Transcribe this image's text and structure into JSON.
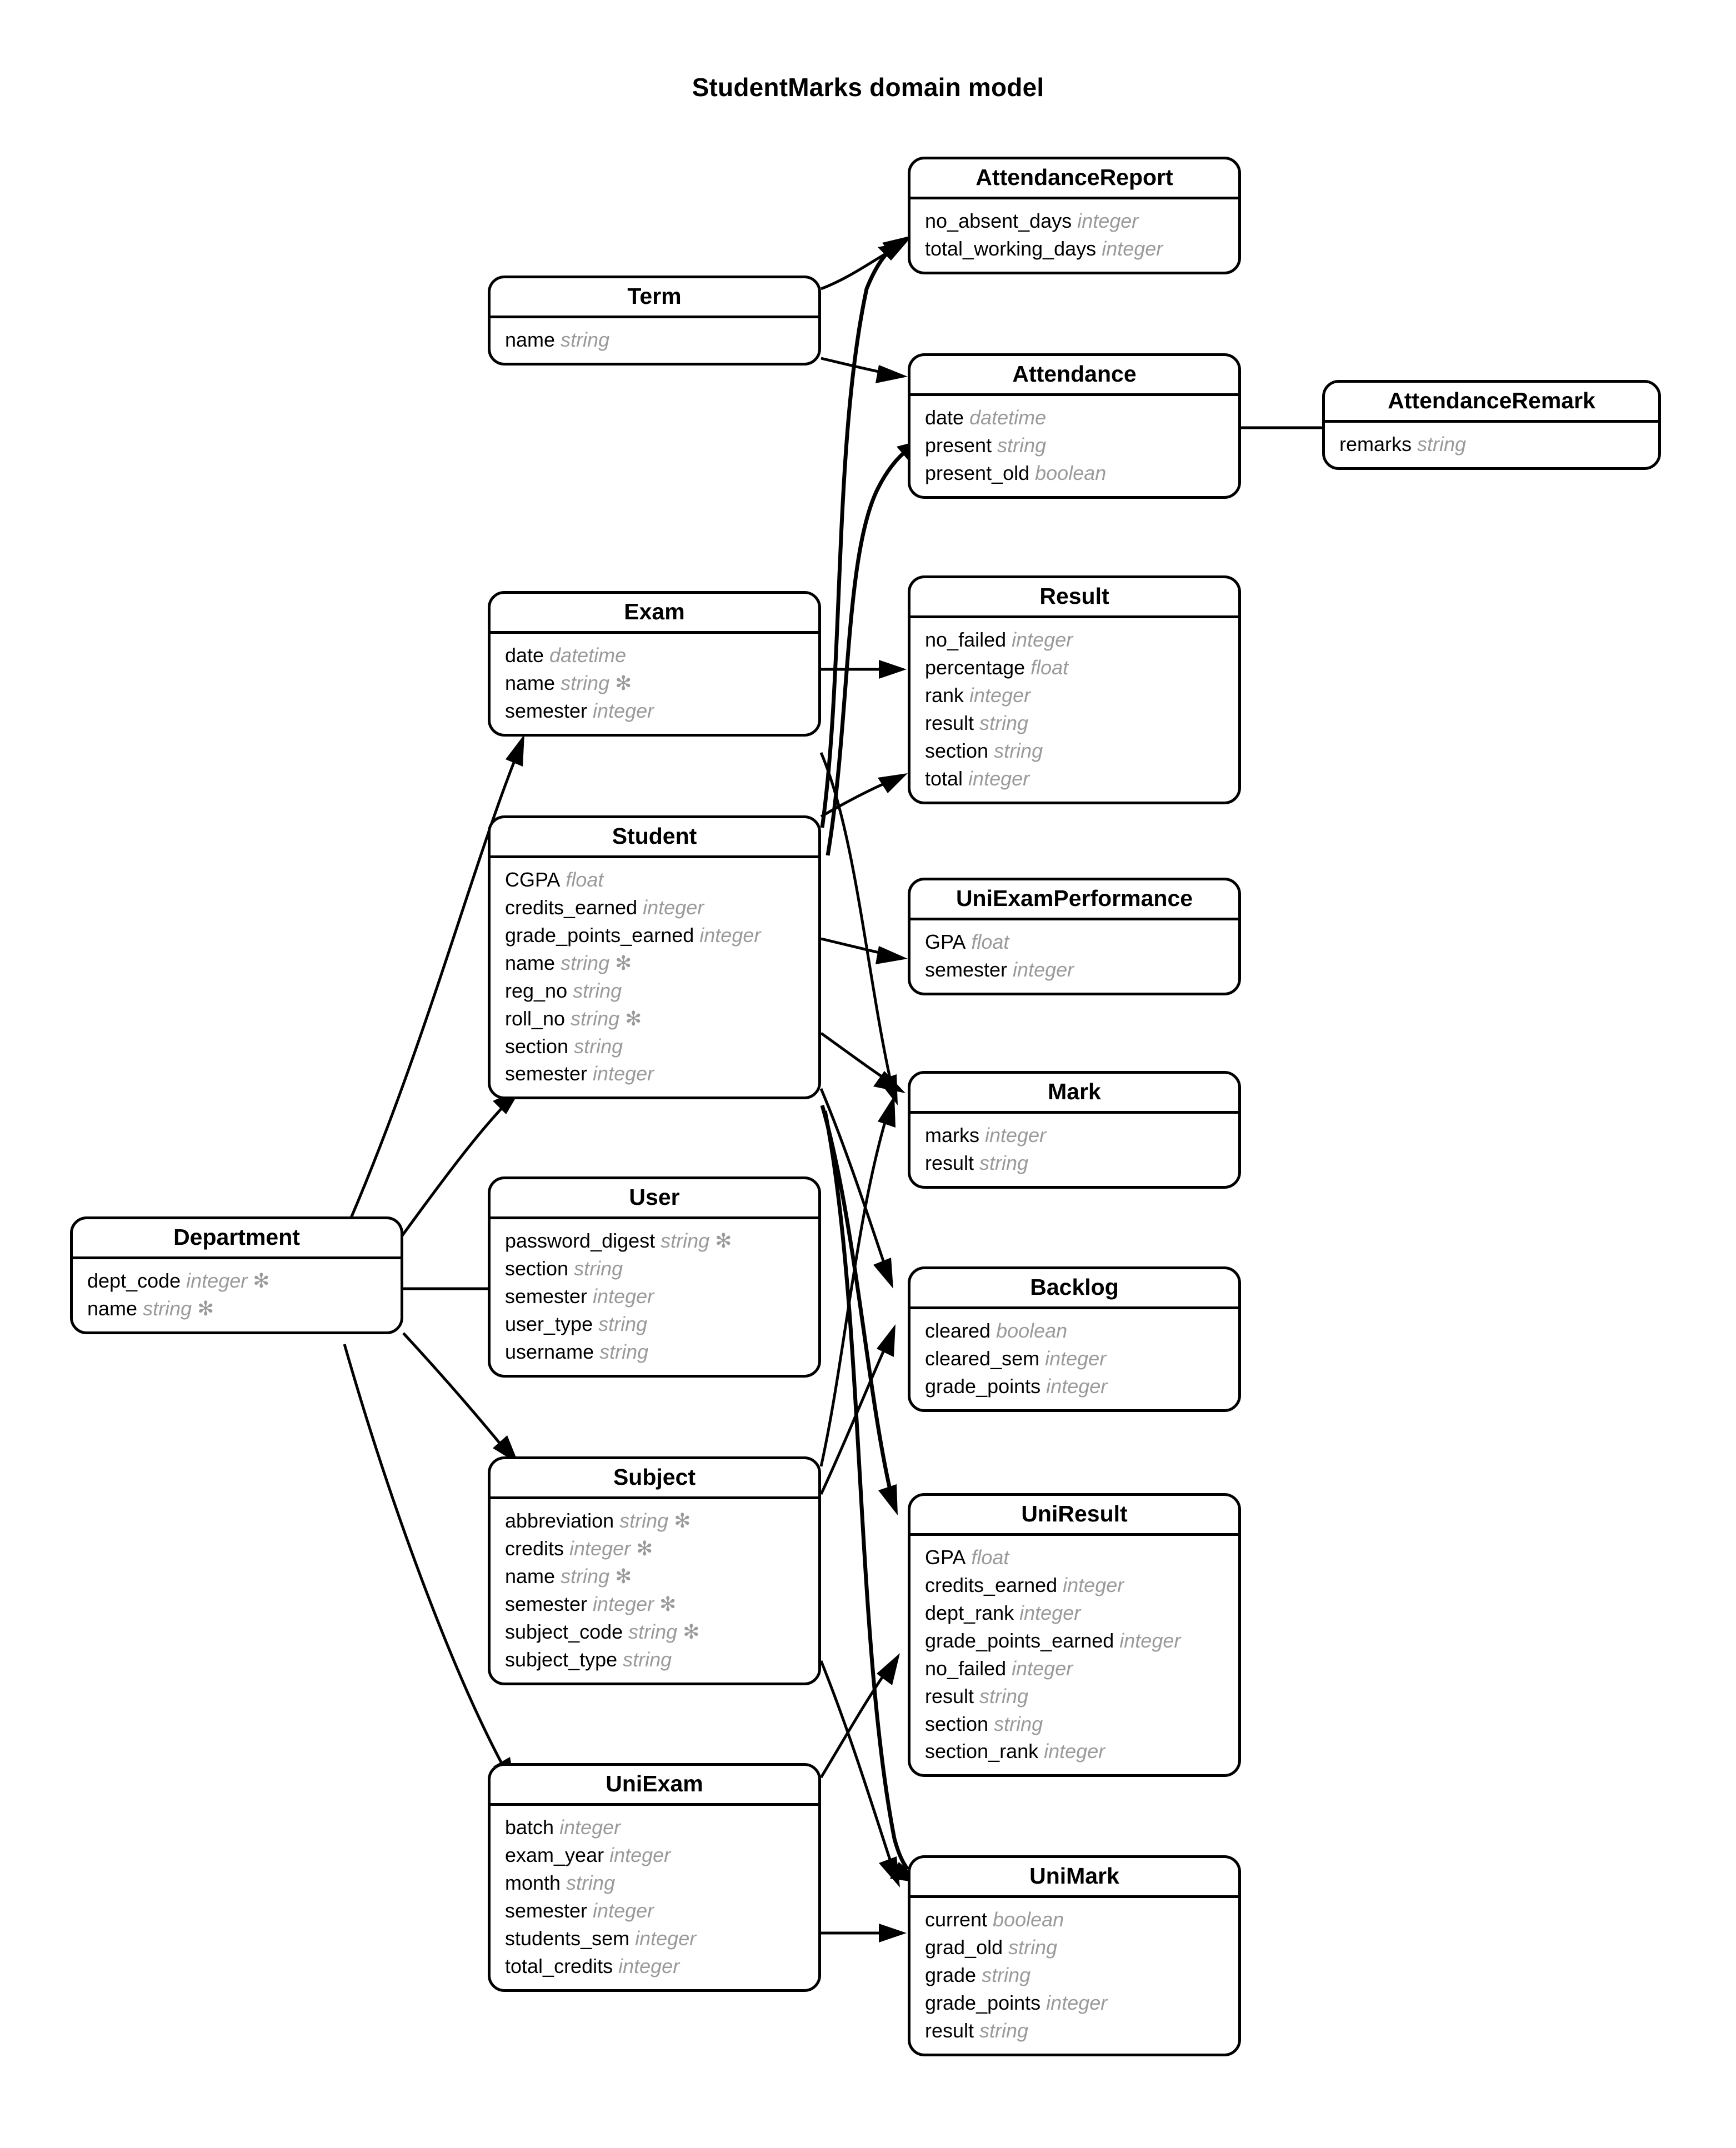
{
  "title": "StudentMarks domain model",
  "entities": [
    {
      "id": "attendance_report",
      "name": "AttendanceReport",
      "attributes": [
        {
          "name": "no_absent_days",
          "type": "integer",
          "required": false
        },
        {
          "name": "total_working_days",
          "type": "integer",
          "required": false
        }
      ]
    },
    {
      "id": "term",
      "name": "Term",
      "attributes": [
        {
          "name": "name",
          "type": "string",
          "required": false
        }
      ]
    },
    {
      "id": "attendance",
      "name": "Attendance",
      "attributes": [
        {
          "name": "date",
          "type": "datetime",
          "required": false
        },
        {
          "name": "present",
          "type": "string",
          "required": false
        },
        {
          "name": "present_old",
          "type": "boolean",
          "required": false
        }
      ]
    },
    {
      "id": "attendance_remark",
      "name": "AttendanceRemark",
      "attributes": [
        {
          "name": "remarks",
          "type": "string",
          "required": false
        }
      ]
    },
    {
      "id": "exam",
      "name": "Exam",
      "attributes": [
        {
          "name": "date",
          "type": "datetime",
          "required": false
        },
        {
          "name": "name",
          "type": "string",
          "required": true
        },
        {
          "name": "semester",
          "type": "integer",
          "required": false
        }
      ]
    },
    {
      "id": "result",
      "name": "Result",
      "attributes": [
        {
          "name": "no_failed",
          "type": "integer",
          "required": false
        },
        {
          "name": "percentage",
          "type": "float",
          "required": false
        },
        {
          "name": "rank",
          "type": "integer",
          "required": false
        },
        {
          "name": "result",
          "type": "string",
          "required": false
        },
        {
          "name": "section",
          "type": "string",
          "required": false
        },
        {
          "name": "total",
          "type": "integer",
          "required": false
        }
      ]
    },
    {
      "id": "student",
      "name": "Student",
      "attributes": [
        {
          "name": "CGPA",
          "type": "float",
          "required": false
        },
        {
          "name": "credits_earned",
          "type": "integer",
          "required": false
        },
        {
          "name": "grade_points_earned",
          "type": "integer",
          "required": false
        },
        {
          "name": "name",
          "type": "string",
          "required": true
        },
        {
          "name": "reg_no",
          "type": "string",
          "required": false
        },
        {
          "name": "roll_no",
          "type": "string",
          "required": true
        },
        {
          "name": "section",
          "type": "string",
          "required": false
        },
        {
          "name": "semester",
          "type": "integer",
          "required": false
        }
      ]
    },
    {
      "id": "uni_exam_performance",
      "name": "UniExamPerformance",
      "attributes": [
        {
          "name": "GPA",
          "type": "float",
          "required": false
        },
        {
          "name": "semester",
          "type": "integer",
          "required": false
        }
      ]
    },
    {
      "id": "mark",
      "name": "Mark",
      "attributes": [
        {
          "name": "marks",
          "type": "integer",
          "required": false
        },
        {
          "name": "result",
          "type": "string",
          "required": false
        }
      ]
    },
    {
      "id": "user",
      "name": "User",
      "attributes": [
        {
          "name": "password_digest",
          "type": "string",
          "required": true
        },
        {
          "name": "section",
          "type": "string",
          "required": false
        },
        {
          "name": "semester",
          "type": "integer",
          "required": false
        },
        {
          "name": "user_type",
          "type": "string",
          "required": false
        },
        {
          "name": "username",
          "type": "string",
          "required": false
        }
      ]
    },
    {
      "id": "backlog",
      "name": "Backlog",
      "attributes": [
        {
          "name": "cleared",
          "type": "boolean",
          "required": false
        },
        {
          "name": "cleared_sem",
          "type": "integer",
          "required": false
        },
        {
          "name": "grade_points",
          "type": "integer",
          "required": false
        }
      ]
    },
    {
      "id": "department",
      "name": "Department",
      "attributes": [
        {
          "name": "dept_code",
          "type": "integer",
          "required": true
        },
        {
          "name": "name",
          "type": "string",
          "required": true
        }
      ]
    },
    {
      "id": "subject",
      "name": "Subject",
      "attributes": [
        {
          "name": "abbreviation",
          "type": "string",
          "required": true
        },
        {
          "name": "credits",
          "type": "integer",
          "required": true
        },
        {
          "name": "name",
          "type": "string",
          "required": true
        },
        {
          "name": "semester",
          "type": "integer",
          "required": true
        },
        {
          "name": "subject_code",
          "type": "string",
          "required": true
        },
        {
          "name": "subject_type",
          "type": "string",
          "required": false
        }
      ]
    },
    {
      "id": "uni_result",
      "name": "UniResult",
      "attributes": [
        {
          "name": "GPA",
          "type": "float",
          "required": false
        },
        {
          "name": "credits_earned",
          "type": "integer",
          "required": false
        },
        {
          "name": "dept_rank",
          "type": "integer",
          "required": false
        },
        {
          "name": "grade_points_earned",
          "type": "integer",
          "required": false
        },
        {
          "name": "no_failed",
          "type": "integer",
          "required": false
        },
        {
          "name": "result",
          "type": "string",
          "required": false
        },
        {
          "name": "section",
          "type": "string",
          "required": false
        },
        {
          "name": "section_rank",
          "type": "integer",
          "required": false
        }
      ]
    },
    {
      "id": "uni_exam",
      "name": "UniExam",
      "attributes": [
        {
          "name": "batch",
          "type": "integer",
          "required": false
        },
        {
          "name": "exam_year",
          "type": "integer",
          "required": false
        },
        {
          "name": "month",
          "type": "string",
          "required": false
        },
        {
          "name": "semester",
          "type": "integer",
          "required": false
        },
        {
          "name": "students_sem",
          "type": "integer",
          "required": false
        },
        {
          "name": "total_credits",
          "type": "integer",
          "required": false
        }
      ]
    },
    {
      "id": "uni_mark",
      "name": "UniMark",
      "attributes": [
        {
          "name": "current",
          "type": "boolean",
          "required": false
        },
        {
          "name": "grad_old",
          "type": "string",
          "required": false
        },
        {
          "name": "grade",
          "type": "string",
          "required": false
        },
        {
          "name": "grade_points",
          "type": "integer",
          "required": false
        },
        {
          "name": "result",
          "type": "string",
          "required": false
        }
      ]
    }
  ],
  "required_marker": "✻",
  "relationships": [
    {
      "from": "term",
      "to": "attendance_report"
    },
    {
      "from": "term",
      "to": "attendance"
    },
    {
      "from": "attendance",
      "to": "attendance_remark",
      "arrow": false
    },
    {
      "from": "exam",
      "to": "result"
    },
    {
      "from": "exam",
      "to": "mark"
    },
    {
      "from": "student",
      "to": "attendance_report"
    },
    {
      "from": "student",
      "to": "attendance"
    },
    {
      "from": "student",
      "to": "result"
    },
    {
      "from": "student",
      "to": "uni_exam_performance"
    },
    {
      "from": "student",
      "to": "mark"
    },
    {
      "from": "student",
      "to": "backlog"
    },
    {
      "from": "student",
      "to": "uni_result"
    },
    {
      "from": "student",
      "to": "uni_mark"
    },
    {
      "from": "department",
      "to": "exam"
    },
    {
      "from": "department",
      "to": "student"
    },
    {
      "from": "department",
      "to": "user"
    },
    {
      "from": "department",
      "to": "subject"
    },
    {
      "from": "department",
      "to": "uni_exam"
    },
    {
      "from": "subject",
      "to": "mark"
    },
    {
      "from": "subject",
      "to": "backlog"
    },
    {
      "from": "subject",
      "to": "uni_mark"
    },
    {
      "from": "uni_exam",
      "to": "uni_result"
    },
    {
      "from": "uni_exam",
      "to": "uni_mark"
    }
  ]
}
